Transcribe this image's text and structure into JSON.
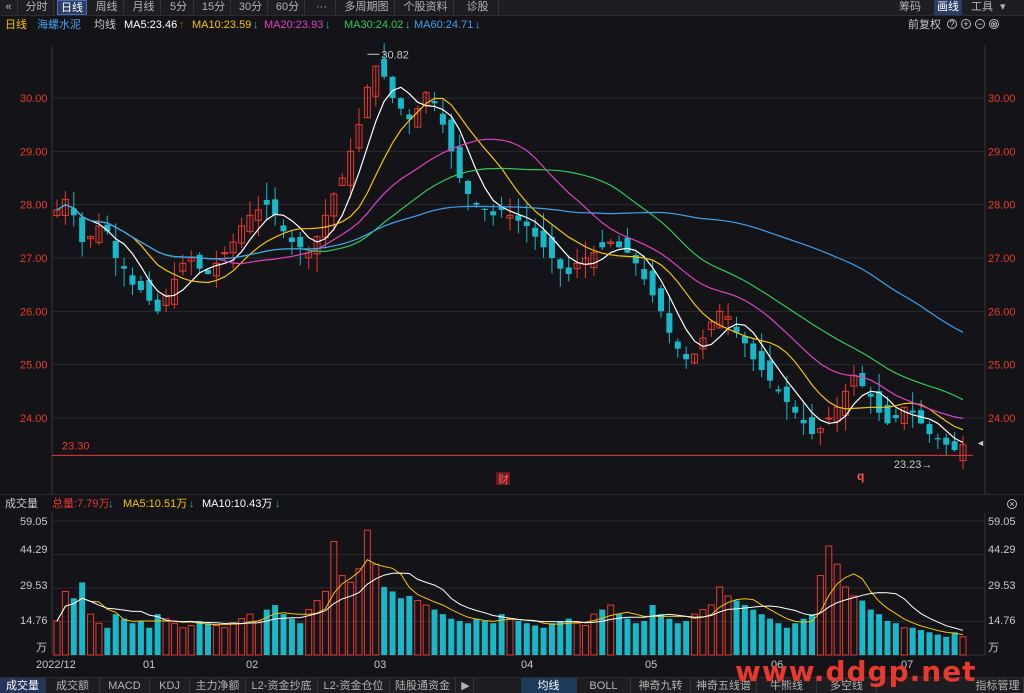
{
  "toolbar": {
    "back_icon": "double-chevron-left-icon",
    "back_glyph": "«",
    "tabs": [
      "分时",
      "日线",
      "周线",
      "月线",
      "5分",
      "15分",
      "30分",
      "60分",
      "···",
      "多周期图",
      "个股资料",
      "诊股"
    ],
    "active_tab": "日线",
    "right": [
      "筹码",
      "画线",
      "工具"
    ],
    "active_right": "画线"
  },
  "info_bar": {
    "period": "日线",
    "stock_name": "海螺水泥",
    "line_type": "均线",
    "ma": [
      {
        "label": "MA5:23.46",
        "dir": "up",
        "color": "#ffffff"
      },
      {
        "label": "MA10:23.59",
        "dir": "down",
        "color": "#f5c400"
      },
      {
        "label": "MA20:23.93",
        "dir": "down",
        "color": "#e040c0"
      },
      {
        "label": "MA30:24.02",
        "dir": "down",
        "color": "#2fc85a"
      },
      {
        "label": "MA60:24.71",
        "dir": "down",
        "color": "#3fa0f0"
      }
    ],
    "adjust": "前复权",
    "controls": [
      "?",
      "+",
      "−",
      "⊗"
    ]
  },
  "colors": {
    "up": "#e8392e",
    "down": "#18b8c8",
    "grid": "#2a2a2e",
    "axis_text": "#e8392e",
    "ma5": "#ffffff",
    "ma10": "#f5c400",
    "ma20": "#e040c0",
    "ma30": "#2fc85a",
    "ma60": "#3fa0f0"
  },
  "price_axis": {
    "ticks": [
      "30.00",
      "29.00",
      "28.00",
      "27.00",
      "26.00",
      "25.00",
      "24.00"
    ]
  },
  "markers": {
    "high_label": "30.82",
    "low_label": "23.23",
    "line_label": "23.30",
    "event_1": "财",
    "event_2": "q",
    "right_arrow": "◄"
  },
  "volume_bar": {
    "title": "成交量",
    "total": "总量:7.79万",
    "total_dir": "down",
    "ma5": "MA5:10.51万",
    "ma5_dir": "down",
    "ma10": "MA10:10.43万",
    "ma10_dir": "down",
    "ticks": [
      "59.05",
      "44.29",
      "29.53",
      "14.76",
      "万"
    ]
  },
  "x_axis": {
    "labels": [
      "2022/12",
      "01",
      "02",
      "03",
      "04",
      "05",
      "06",
      "07"
    ]
  },
  "bottom_tabs": {
    "left": [
      "成交量",
      "成交额",
      "MACD",
      "KDJ",
      "主力净额",
      "L2-资金抄底",
      "L2-资金仓位",
      "陆股通资金"
    ],
    "arrow": "▶",
    "right": [
      "均线",
      "BOLL",
      "神奇九转",
      "神奇五线谱",
      "牛熊线",
      "多空线"
    ],
    "active_left": "成交量",
    "active_right": "均线",
    "manage": "指标管理"
  },
  "watermark": "www.ddgp.net",
  "chart_data": {
    "type": "candlestick",
    "title": "",
    "price_range": [
      23.0,
      31.0
    ],
    "volume_range": [
      0,
      59.05
    ],
    "volume_unit": "万",
    "series_note": "daily OHLC closes approx.",
    "closes": [
      27.9,
      28.1,
      27.8,
      27.3,
      27.4,
      27.6,
      27.5,
      27.0,
      26.8,
      26.5,
      26.4,
      26.2,
      26.0,
      26.3,
      26.6,
      26.9,
      27.0,
      26.8,
      26.7,
      26.9,
      27.1,
      27.3,
      27.6,
      27.8,
      27.9,
      28.0,
      27.8,
      27.5,
      27.3,
      27.2,
      27.1,
      27.4,
      27.8,
      28.2,
      28.5,
      29.0,
      29.5,
      30.2,
      30.6,
      30.4,
      30.0,
      29.8,
      29.6,
      29.8,
      30.1,
      29.9,
      29.5,
      29.0,
      28.5,
      28.2,
      28.0,
      27.9,
      27.8,
      27.9,
      27.8,
      27.7,
      27.6,
      27.4,
      27.2,
      27.0,
      26.8,
      26.7,
      26.9,
      27.0,
      27.1,
      27.2,
      27.3,
      27.2,
      27.1,
      26.9,
      26.6,
      26.3,
      26.0,
      25.6,
      25.3,
      25.1,
      25.2,
      25.5,
      25.8,
      26.0,
      25.9,
      25.6,
      25.4,
      25.1,
      24.9,
      24.7,
      24.5,
      24.3,
      24.1,
      23.9,
      23.7,
      23.8,
      24.0,
      24.2,
      24.5,
      24.8,
      24.6,
      24.4,
      24.1,
      23.9,
      24.0,
      24.2,
      24.1,
      23.9,
      23.7,
      23.6,
      23.5,
      23.4,
      23.5
    ],
    "volumes": [
      15,
      28,
      25,
      32,
      18,
      14,
      12,
      18,
      16,
      14,
      15,
      12,
      18,
      16,
      14,
      12,
      13,
      15,
      14,
      13,
      12,
      14,
      16,
      18,
      15,
      20,
      22,
      18,
      16,
      14,
      20,
      24,
      28,
      50,
      35,
      32,
      38,
      55,
      40,
      30,
      28,
      25,
      26,
      24,
      22,
      20,
      18,
      16,
      15,
      14,
      16,
      15,
      14,
      18,
      16,
      15,
      14,
      13,
      12,
      14,
      15,
      16,
      14,
      13,
      18,
      20,
      22,
      18,
      16,
      14,
      15,
      22,
      18,
      16,
      14,
      15,
      18,
      20,
      22,
      30,
      26,
      24,
      22,
      20,
      18,
      16,
      14,
      12,
      14,
      16,
      18,
      35,
      48,
      40,
      30,
      26,
      24,
      20,
      18,
      15,
      14,
      12,
      12,
      11,
      10,
      9,
      8,
      10,
      8
    ],
    "ma_last": {
      "MA5": 23.46,
      "MA10": 23.59,
      "MA20": 23.93,
      "MA30": 24.02,
      "MA60": 24.71
    },
    "high": 30.82,
    "low": 23.23
  }
}
